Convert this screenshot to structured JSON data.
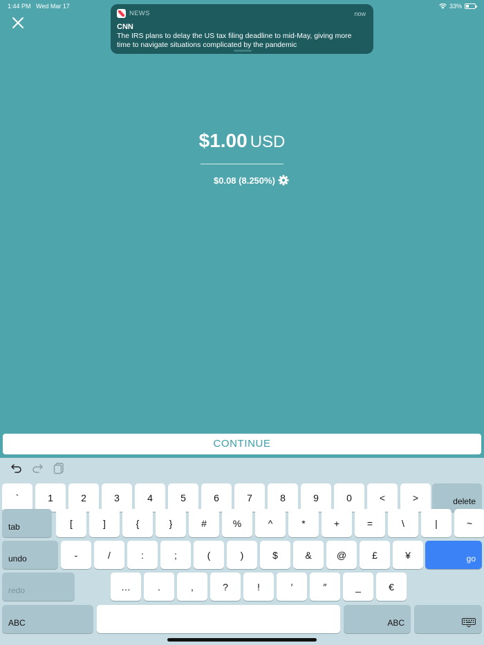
{
  "status_bar": {
    "time": "1:44 PM",
    "date": "Wed Mar 17",
    "battery": "33%",
    "battery_level": 0.33
  },
  "notification": {
    "app": "NEWS",
    "time": "now",
    "title": "CNN",
    "body": "The IRS plans to delay the US tax filing deadline to mid-May, giving more time to navigate situations complicated by the pandemic"
  },
  "payment": {
    "amount": "$1.00",
    "currency": "USD",
    "tax": "$0.08 (8.250%)"
  },
  "continue_label": "CONTINUE",
  "icons": {
    "close": "close-icon",
    "settings": "gear-icon",
    "undo": "undo-icon",
    "redo": "redo-icon",
    "paste": "paste-icon",
    "keyboard": "keyboard-icon"
  },
  "colors": {
    "background": "#4ea6ac",
    "accent": "#3aa0a6",
    "go_key": "#3b82f6"
  },
  "keyboard": {
    "row1": [
      "`",
      "1",
      "2",
      "3",
      "4",
      "5",
      "6",
      "7",
      "8",
      "9",
      "0",
      "<",
      ">"
    ],
    "delete": "delete",
    "tab": "tab",
    "row2": [
      "[",
      "]",
      "{",
      "}",
      "#",
      "%",
      "^",
      "*",
      "+",
      "=",
      "\\",
      "|",
      "~"
    ],
    "undo": "undo",
    "row3": [
      "-",
      "/",
      ":",
      ";",
      "(",
      ")",
      "$",
      "&",
      "@",
      "£",
      "¥"
    ],
    "go": "go",
    "redo": "redo",
    "row4": [
      "…",
      ".",
      ",",
      "?",
      "!",
      "′",
      "″",
      "_",
      "€"
    ],
    "abc_left": "ABC",
    "abc_right": "ABC"
  }
}
